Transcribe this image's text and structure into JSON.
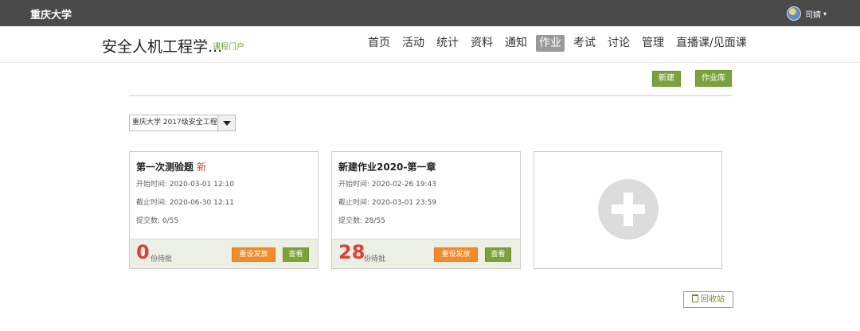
{
  "topbar": {
    "school": "重庆大学",
    "username": "司婧"
  },
  "course": {
    "title": "安全人机工程学...",
    "portal_link": "课程门户"
  },
  "nav": [
    {
      "label": "首页"
    },
    {
      "label": "活动"
    },
    {
      "label": "统计"
    },
    {
      "label": "资料"
    },
    {
      "label": "通知"
    },
    {
      "label": "作业",
      "active": true
    },
    {
      "label": "考试"
    },
    {
      "label": "讨论"
    },
    {
      "label": "管理"
    },
    {
      "label": "直播课/见面课"
    }
  ],
  "actions": {
    "new_label": "新建",
    "library_label": "作业库"
  },
  "class_select": {
    "value": "重庆大学 2017级安全工程"
  },
  "assignments": [
    {
      "title": "第一次测验题",
      "new_badge": "新",
      "start_label": "开始时间:",
      "start": "2020-03-01 12:10",
      "end_label": "截止时间:",
      "end": "2020-06-30 12:11",
      "submit_label": "提交数:",
      "submitted": "0/55",
      "pending": "0",
      "pending_label": "份待批",
      "reissue_label": "重设发放",
      "view_label": "查看"
    },
    {
      "title": "新建作业2020-第一章",
      "start_label": "开始时间:",
      "start": "2020-02-26 19:43",
      "end_label": "截止时间:",
      "end": "2020-03-01 23:59",
      "submit_label": "提交数:",
      "submitted": "28/55",
      "pending": "28",
      "pending_label": "份待批",
      "reissue_label": "重设发放",
      "view_label": "查看"
    }
  ],
  "recycle_label": "回收站",
  "colors": {
    "accent_green": "#7ca33a",
    "accent_orange": "#f28c2b",
    "alert_red": "#e0403a",
    "topbar": "#4a4a4a"
  }
}
